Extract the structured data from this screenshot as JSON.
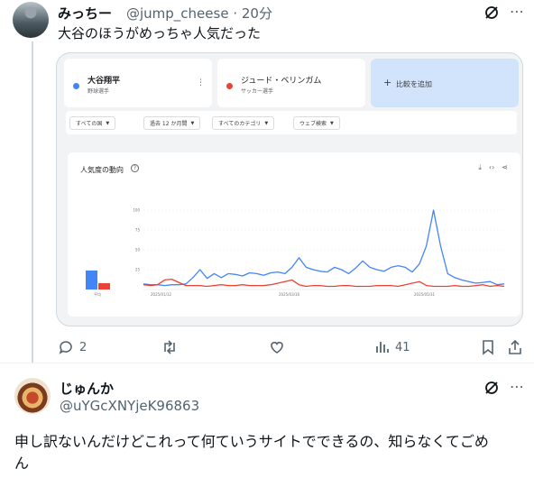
{
  "tweet1": {
    "name": "みっちー",
    "handle": "@jump_cheese · 20分",
    "text": "大谷のほうがめっちゃ人気だった",
    "actions": {
      "replies": "2",
      "views": "41"
    }
  },
  "embed": {
    "terms": [
      {
        "name": "大谷翔平",
        "sub": "野球選手",
        "color": "#4285f4",
        "menu": "⋮"
      },
      {
        "name": "ジュード・ベリンガム",
        "sub": "サッカー選手",
        "color": "#ea4335"
      }
    ],
    "add_label": "比較を追加",
    "add_plus": "+",
    "filters": [
      "すべての国",
      "過去 12 か月間",
      "すべてのカテゴリ",
      "ウェブ検索"
    ],
    "chart_title": "人気度の動向",
    "help_glyph": "?",
    "tools": [
      "⤓",
      "‹›",
      "⋖"
    ]
  },
  "chart_data": {
    "type": "line",
    "title": "人気度の動向",
    "ylim": [
      0,
      100
    ],
    "yticks": [
      "100",
      "75",
      "50",
      "25"
    ],
    "xticks": [
      "2025/01/12",
      "2025/03/16",
      "2025/05/31"
    ],
    "avg_label": "平均",
    "averages": [
      24,
      8
    ],
    "series": [
      {
        "name": "大谷翔平",
        "color": "#4285f4",
        "values": [
          7,
          6,
          6,
          5,
          6,
          6,
          7,
          15,
          25,
          14,
          20,
          15,
          20,
          19,
          17,
          21,
          20,
          18,
          21,
          22,
          20,
          28,
          40,
          28,
          25,
          23,
          22,
          28,
          25,
          20,
          27,
          36,
          28,
          25,
          23,
          28,
          30,
          28,
          22,
          32,
          55,
          100,
          55,
          20,
          15,
          12,
          10,
          8,
          9,
          10,
          6,
          7
        ]
      },
      {
        "name": "ジュード・ベリンガム",
        "color": "#ea4335",
        "values": [
          6,
          5,
          6,
          12,
          13,
          9,
          5,
          5,
          5,
          4,
          5,
          6,
          5,
          5,
          6,
          5,
          5,
          5,
          6,
          8,
          10,
          12,
          6,
          4,
          5,
          5,
          4,
          4,
          5,
          5,
          4,
          4,
          4,
          5,
          5,
          5,
          4,
          6,
          8,
          10,
          5,
          4,
          4,
          4,
          5,
          4,
          4,
          5,
          6,
          4,
          5,
          4
        ]
      }
    ]
  },
  "tweet2": {
    "name": "じゅんか",
    "handle": "@uYGcXNYjeK96863",
    "text_line1": "申し訳ないんだけどこれって何ていうサイトでできるの、知らなくてごめ",
    "text_line2": "ん"
  },
  "icons": {
    "grok": "grok-icon",
    "more": "⋯",
    "reply": "reply-icon",
    "retweet": "retweet-icon",
    "like": "heart-icon",
    "views": "views-icon",
    "bookmark": "bookmark-icon",
    "share": "share-icon"
  }
}
